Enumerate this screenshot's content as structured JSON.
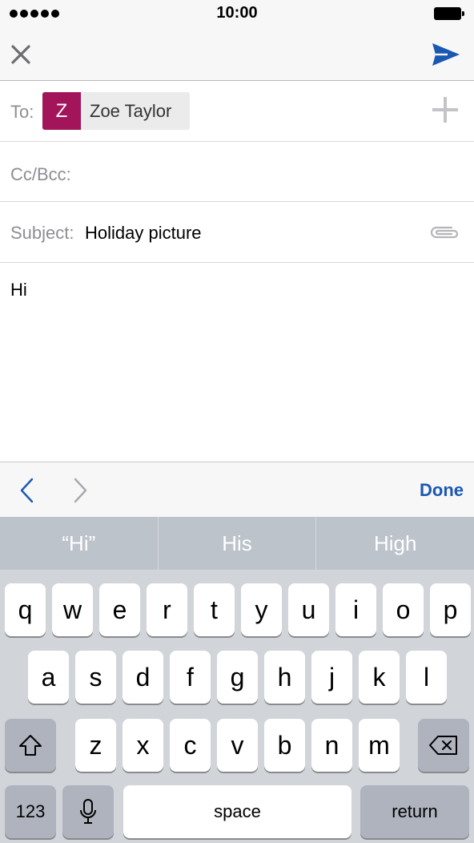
{
  "status_bar": {
    "time": "10:00"
  },
  "nav": {
    "close_icon": "close-icon",
    "send_icon": "send-icon"
  },
  "compose": {
    "to_label": "To:",
    "recipient": {
      "initial": "Z",
      "name": "Zoe Taylor",
      "avatar_color": "#a3155a"
    },
    "cc_label": "Cc/Bcc:",
    "subject_label": "Subject:",
    "subject_value": "Holiday picture",
    "body": "Hi"
  },
  "toolbar": {
    "done_label": "Done",
    "accent_color": "#1a58b2"
  },
  "keyboard": {
    "suggestions": [
      "“Hi”",
      "His",
      "High"
    ],
    "row1": [
      "q",
      "w",
      "e",
      "r",
      "t",
      "y",
      "u",
      "i",
      "o",
      "p"
    ],
    "row2": [
      "a",
      "s",
      "d",
      "f",
      "g",
      "h",
      "j",
      "k",
      "l"
    ],
    "row3": [
      "z",
      "x",
      "c",
      "v",
      "b",
      "n",
      "m"
    ],
    "numbers_label": "123",
    "space_label": "space",
    "return_label": "return"
  }
}
